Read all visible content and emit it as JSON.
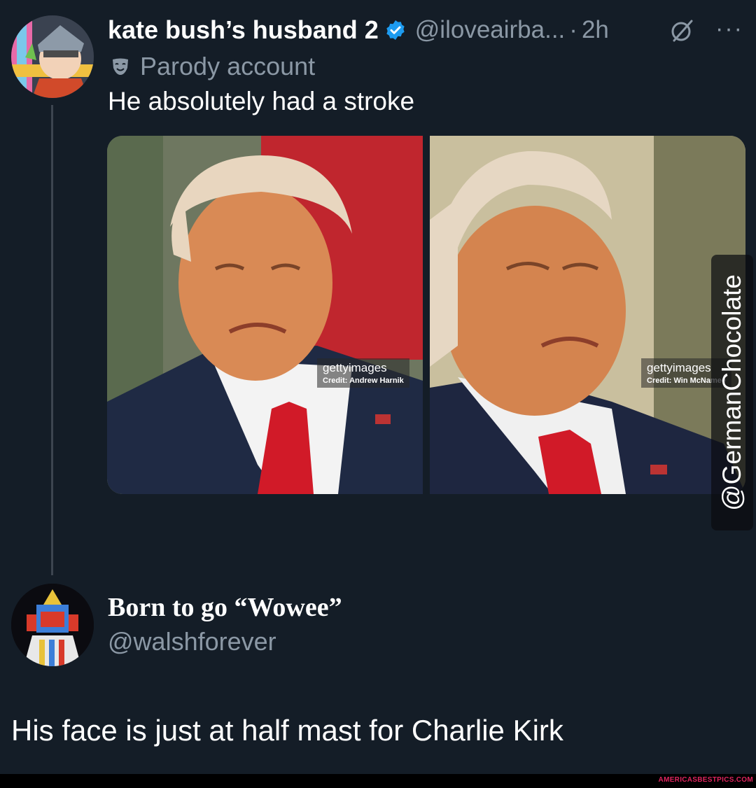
{
  "tweet": {
    "display_name": "kate bush’s husband 2",
    "handle": "@iloveairba...",
    "separator": "·",
    "time": "2h",
    "more_icon": "···",
    "parody_label": "Parody account",
    "text": "He absolutely had a stroke",
    "verified_color": "#1d9bf0"
  },
  "media": {
    "left": {
      "brand_bold": "getty",
      "brand_light": "images",
      "credit": "Credit: Andrew Harnik"
    },
    "right": {
      "brand_bold": "getty",
      "brand_light": "images",
      "credit": "Credit: Win McNamee"
    }
  },
  "reply": {
    "display_name": "Born to go “Wowee”",
    "handle": "@walshforever",
    "text": "His face is just at half mast for Charlie Kirk"
  },
  "overlay": {
    "side_credit": "@GermanChocolate",
    "footer_site": "AMERICASBESTPICS.COM"
  }
}
